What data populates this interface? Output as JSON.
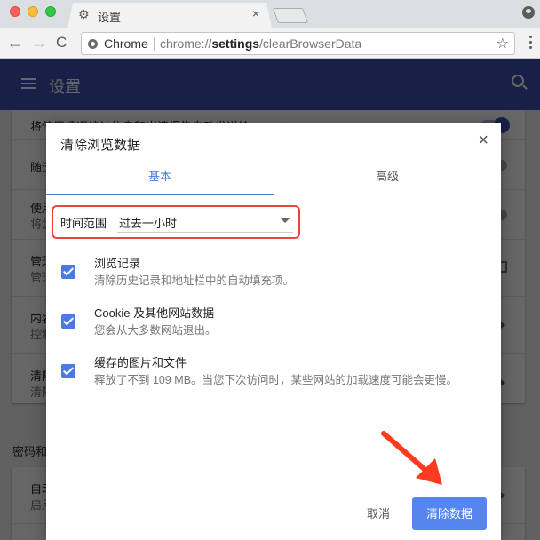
{
  "browser": {
    "tab_title": "设置",
    "tab_icon": "gear-icon",
    "omnibox": {
      "site_label": "Chrome",
      "url_prefix": "chrome://",
      "url_bold": "settings",
      "url_suffix": "/clearBrowserData"
    },
    "glyphs": {
      "back": "←",
      "forward": "→",
      "reload": "C",
      "star": "☆",
      "close": "×"
    }
  },
  "settings": {
    "header_title": "设置",
    "rows": [
      {
        "title": "将使用情况统计信息和崩溃报告自动发送给 Google",
        "desc": "",
        "control": "toggle-on"
      },
      {
        "title": "随浏",
        "desc": "",
        "control": "toggle-off"
      },
      {
        "title": "使用",
        "desc": "将您",
        "control": "toggle-off"
      },
      {
        "title": "管理",
        "desc": "管理",
        "control": "external-link"
      },
      {
        "title": "内容",
        "desc": "控制",
        "control": "arrow"
      },
      {
        "title": "清除",
        "desc": "清除",
        "control": "arrow"
      }
    ],
    "section_title": "密码和",
    "section_rows": [
      {
        "title": "自动",
        "desc": "启用",
        "control": "arrow"
      }
    ]
  },
  "dialog": {
    "title": "清除浏览数据",
    "close_glyph": "×",
    "tabs": [
      {
        "label": "基本",
        "active": true
      },
      {
        "label": "高级",
        "active": false
      }
    ],
    "time_range": {
      "label": "时间范围",
      "value": "过去一小时"
    },
    "options": [
      {
        "title": "浏览记录",
        "desc": "清除历史记录和地址栏中的自动填充项。",
        "checked": true
      },
      {
        "title": "Cookie 及其他网站数据",
        "desc": "您会从大多数网站退出。",
        "checked": true
      },
      {
        "title": "缓存的图片和文件",
        "desc": "释放了不到 109 MB。当您下次访问时，某些网站的加载速度可能会更慢。",
        "checked": true
      }
    ],
    "cancel_label": "取消",
    "confirm_label": "清除数据"
  },
  "colors": {
    "accent": "#4c7be0",
    "header": "#3f51b5",
    "highlight_border": "#ef4141",
    "annotation_arrow": "#ff3b1f",
    "primary_button": "#5585ee"
  }
}
